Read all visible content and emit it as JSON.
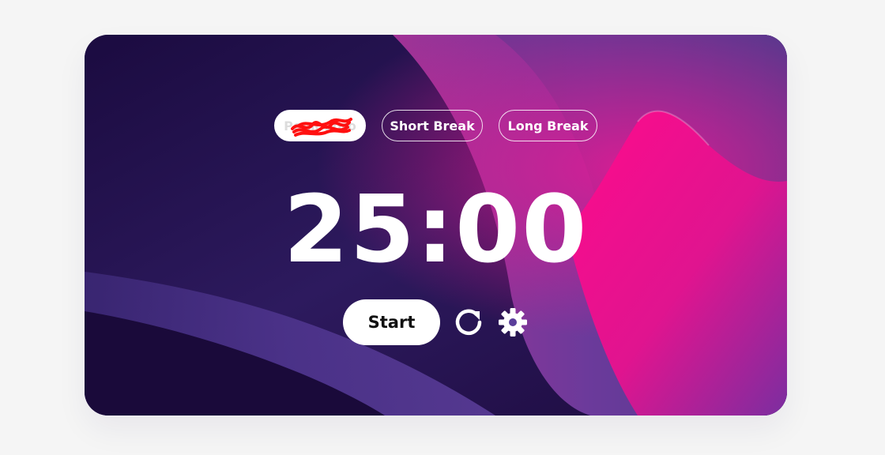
{
  "timer": {
    "modes": [
      {
        "label": "Pomodoro",
        "active": true,
        "obscured": true
      },
      {
        "label": "Short Break",
        "active": false
      },
      {
        "label": "Long Break",
        "active": false
      }
    ],
    "time": "25:00",
    "start_label": "Start"
  },
  "icons": {
    "reset": "reset-icon",
    "settings": "gear-icon"
  },
  "colors": {
    "card_base": "#1e0c45",
    "pink_accent": "#ff0a8c",
    "purple_mid": "#563b98",
    "scribble_red": "#ff1010"
  }
}
